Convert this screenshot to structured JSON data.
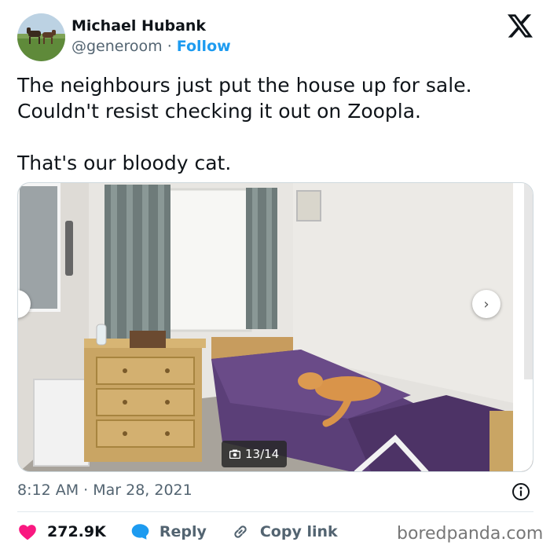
{
  "author": {
    "name": "Michael Hubank",
    "handle": "@generoom",
    "separator": "·",
    "follow_label": "Follow"
  },
  "tweet": {
    "line1": "The neighbours just put the house up for sale.",
    "line2": "Couldn't resist checking it out on Zoopla.",
    "line3": "That's our bloody cat."
  },
  "media": {
    "counter": "13/14",
    "next_glyph": "›"
  },
  "meta": {
    "timestamp": "8:12 AM · Mar 28, 2021"
  },
  "actions": {
    "likes": "272.9K",
    "reply_label": "Reply",
    "copy_label": "Copy link"
  },
  "watermark": "boredpanda.com",
  "colors": {
    "like_red": "#f91880",
    "reply_blue": "#1d9bf0",
    "link_blue": "#1d9bf0",
    "text_gray": "#536471"
  },
  "icons": {
    "logo": "x-logo",
    "like": "heart-icon",
    "reply": "speech-bubble-icon",
    "copy": "link-icon",
    "info": "info-icon",
    "counter": "camera-icon"
  }
}
